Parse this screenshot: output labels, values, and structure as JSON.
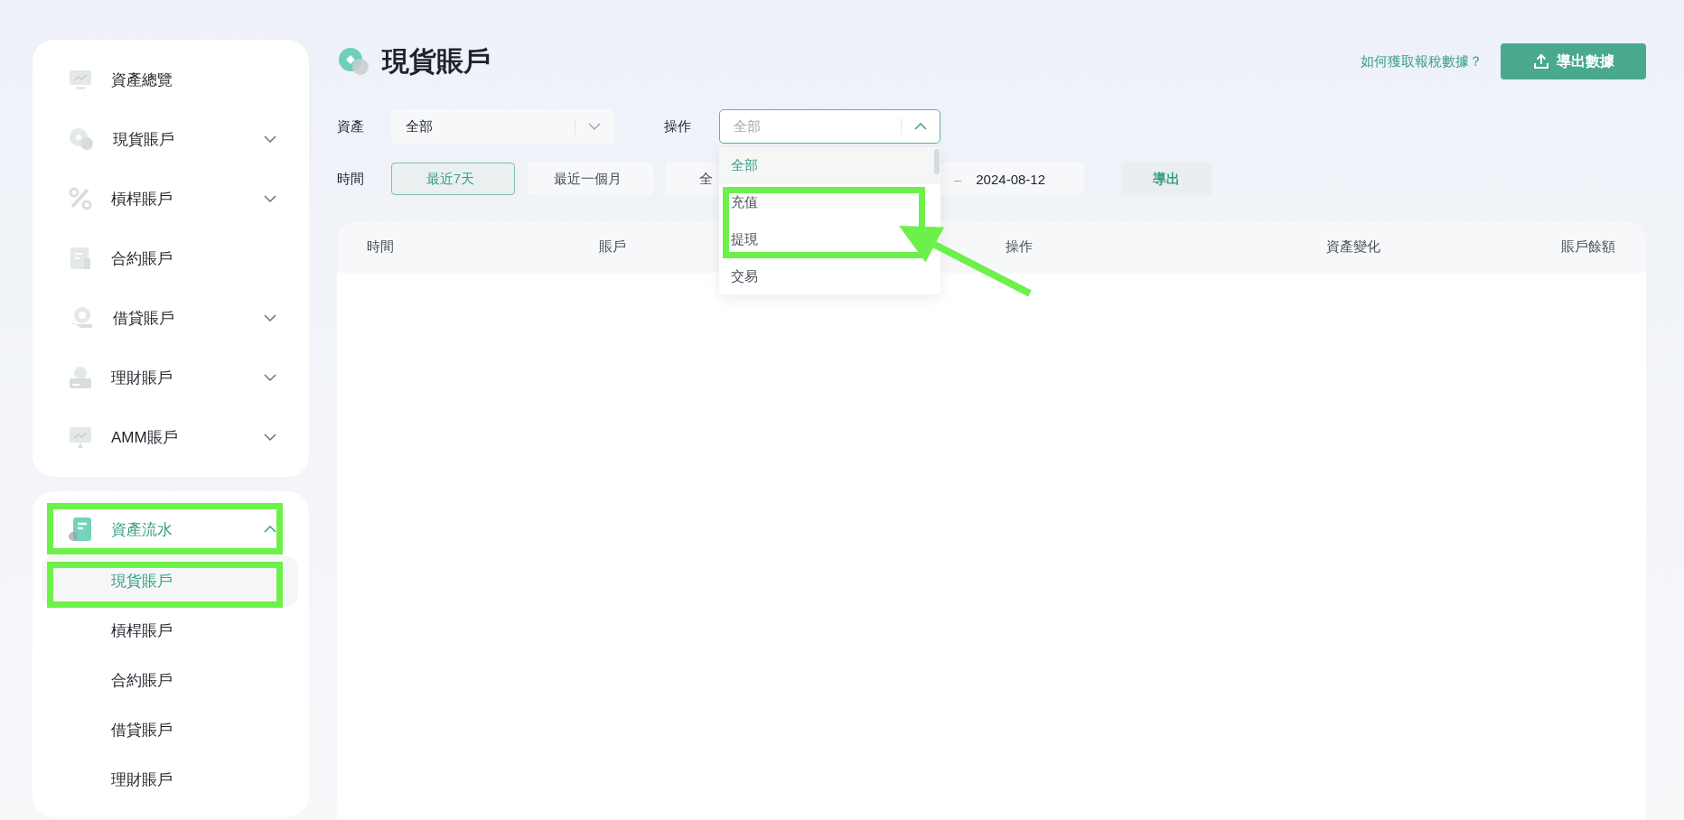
{
  "sidebar": {
    "cards": [
      {
        "items": [
          {
            "label": "資產總覽"
          },
          {
            "label": "現貨賬戶",
            "expanded": false
          },
          {
            "label": "槓桿賬戶",
            "expanded": false
          },
          {
            "label": "合約賬戶"
          },
          {
            "label": "借貸賬戶",
            "expanded": false
          },
          {
            "label": "理財賬戶",
            "expanded": false
          },
          {
            "label": "AMM賬戶",
            "expanded": false
          }
        ]
      },
      {
        "items": [
          {
            "label": "資產流水",
            "expanded": true,
            "selected": true,
            "children": [
              {
                "label": "現貨賬戶",
                "selected": true
              },
              {
                "label": "槓桿賬戶",
                "selected": false
              },
              {
                "label": "合約賬戶",
                "selected": false
              },
              {
                "label": "借貸賬戶",
                "selected": false
              },
              {
                "label": "理財賬戶",
                "selected": false
              }
            ]
          }
        ]
      }
    ]
  },
  "header": {
    "title": "現貨賬戶",
    "help_link": "如何獲取報稅數據？",
    "export_button": "導出數據"
  },
  "filters": {
    "asset": {
      "label": "資產",
      "value": "全部"
    },
    "operation": {
      "label": "操作",
      "placeholder": "全部",
      "open": true,
      "options": [
        {
          "label": "全部",
          "selected": true
        },
        {
          "label": "充值",
          "selected": false
        },
        {
          "label": "提現",
          "selected": false
        },
        {
          "label": "交易",
          "selected": false
        }
      ]
    },
    "time": {
      "label": "時間",
      "ranges": [
        {
          "label": "最近7天",
          "selected": true
        },
        {
          "label": "最近一個月",
          "selected": false
        },
        {
          "label": "全",
          "selected": false
        }
      ],
      "separator": "–",
      "end_date": "2024-08-12"
    },
    "export_button": "導出"
  },
  "table": {
    "columns": [
      "時間",
      "賬戶",
      "操作",
      "資產變化",
      "賬戶餘額"
    ]
  }
}
